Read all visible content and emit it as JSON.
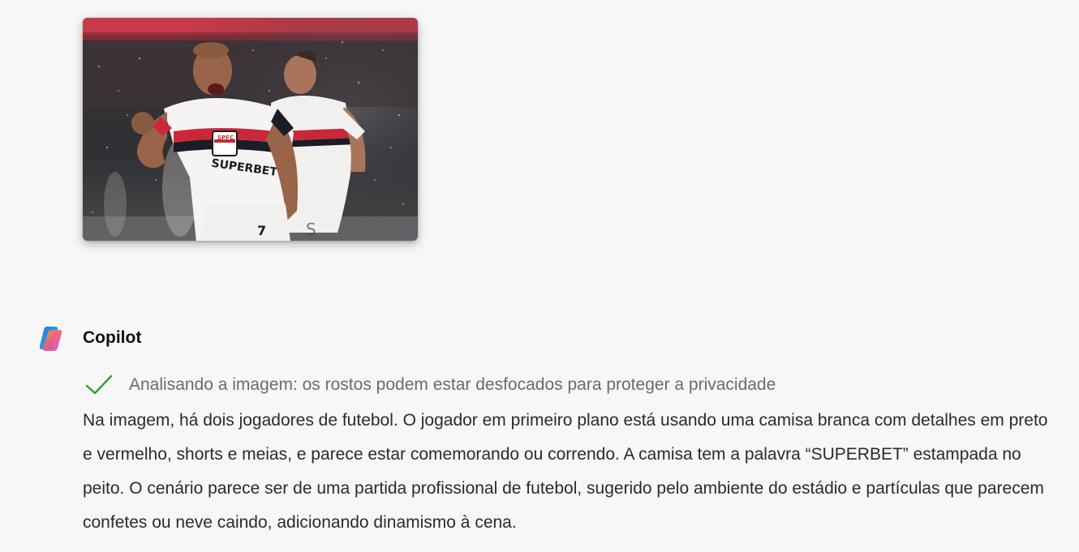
{
  "user_message": {
    "image_alt": "Jogadores de futebol comemorando em campo"
  },
  "assistant": {
    "name": "Copilot",
    "logo_icon": "copilot-logo-icon",
    "status": {
      "icon": "checkmark-icon",
      "text": "Analisando a imagem: os rostos podem estar desfocados para proteger a privacidade"
    },
    "response": "Na imagem, há dois jogadores de futebol. O jogador em primeiro plano está usando uma camisa branca com detalhes em preto e vermelho, shorts e meias, e parece estar comemorando ou correndo. A camisa tem a palavra “SUPERBET” estampada no peito. O cenário parece ser de uma partida profissional de futebol, sugerido pelo ambiente do estádio e partículas que parecem confetes ou neve caindo, adicionando dinamismo à cena."
  },
  "colors": {
    "background": "#f7f7f7",
    "check_green": "#2e9e2e",
    "status_text": "#6b6b6b"
  },
  "image_text": {
    "shirt_sponsor": "SUPERBET",
    "crest": "SPFC"
  }
}
